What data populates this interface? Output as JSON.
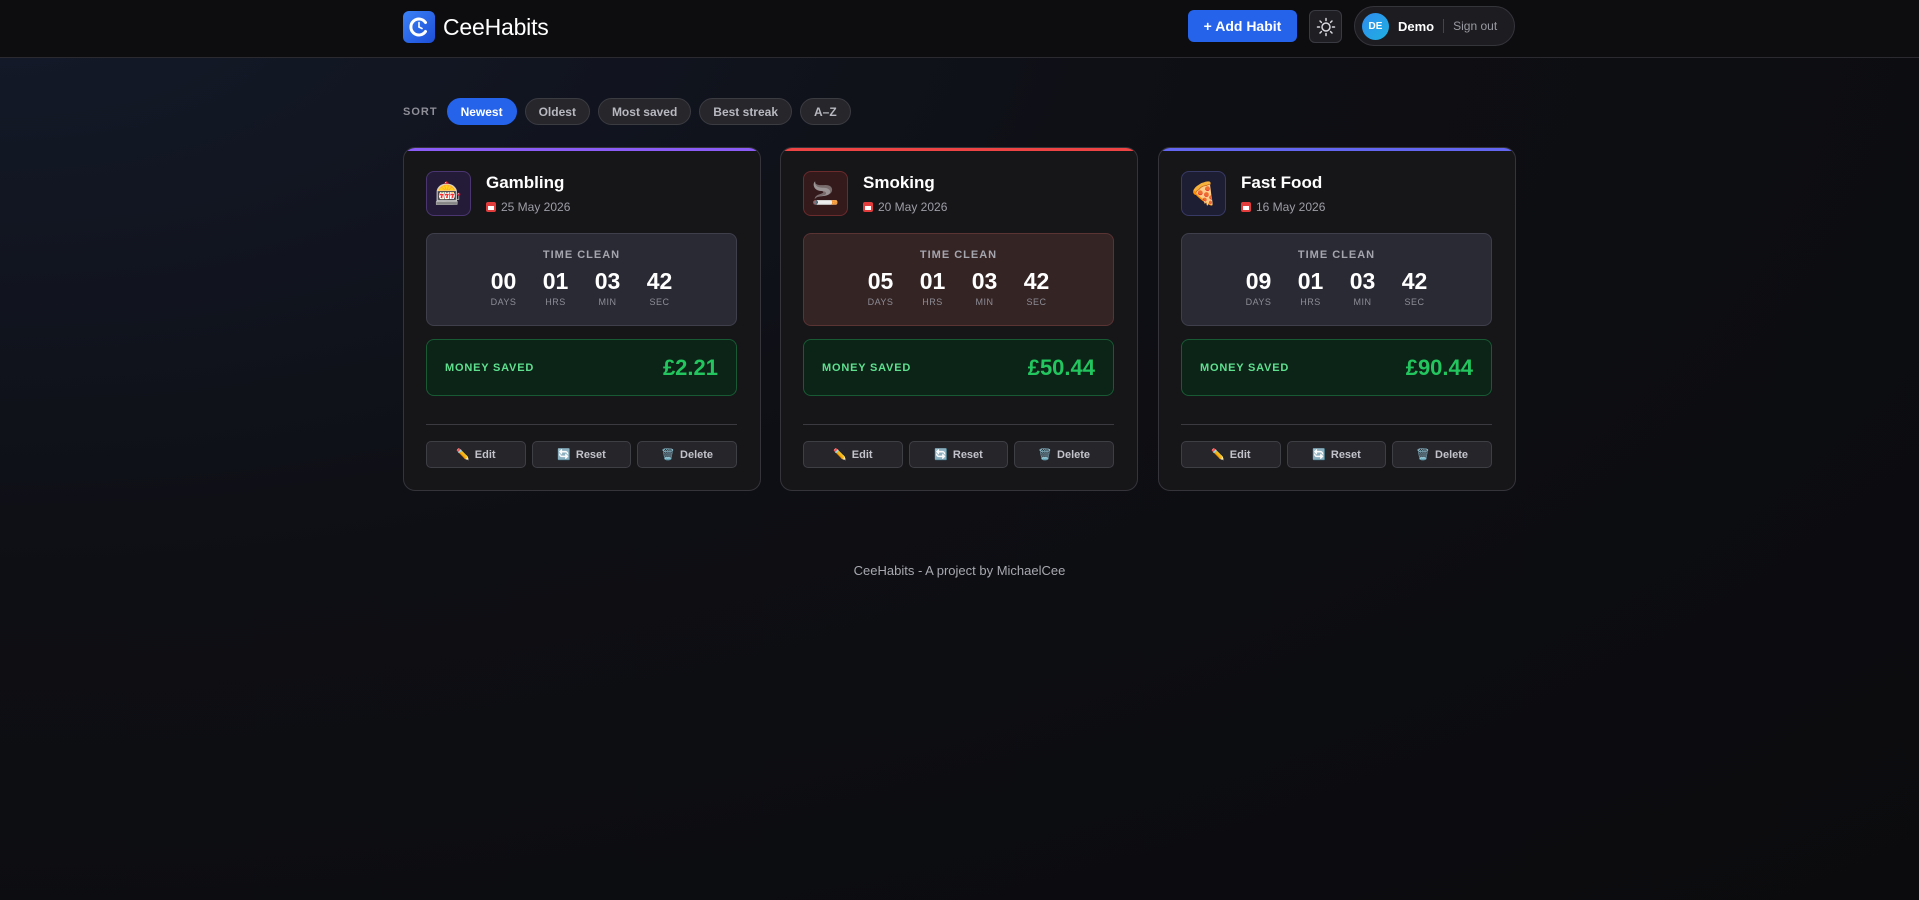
{
  "header": {
    "brand": "CeeHabits",
    "add_habit_label": "+ Add Habit",
    "user_initials": "DE",
    "user_name": "Demo",
    "signout_label": "Sign out"
  },
  "sort": {
    "label": "SORT",
    "options": [
      "Newest",
      "Oldest",
      "Most saved",
      "Best streak",
      "A–Z"
    ],
    "selected": "Newest"
  },
  "cards": [
    {
      "name": "Gambling",
      "icon": "slot-machine-icon",
      "emoji": "🎰",
      "date": "25 May 2026",
      "accent": "#8b5cf6",
      "time_label": "TIME CLEAN",
      "time": [
        {
          "value": "00",
          "unit": "DAYS"
        },
        {
          "value": "01",
          "unit": "HRS"
        },
        {
          "value": "03",
          "unit": "MIN"
        },
        {
          "value": "42",
          "unit": "SEC"
        }
      ],
      "money_label": "MONEY SAVED",
      "money_value": "£2.21",
      "actions": {
        "edit": "Edit",
        "reset": "Reset",
        "delete": "Delete"
      }
    },
    {
      "name": "Smoking",
      "icon": "cigarette-icon",
      "emoji": "🚬",
      "date": "20 May 2026",
      "accent": "#ef4444",
      "time_label": "TIME CLEAN",
      "time": [
        {
          "value": "05",
          "unit": "DAYS"
        },
        {
          "value": "01",
          "unit": "HRS"
        },
        {
          "value": "03",
          "unit": "MIN"
        },
        {
          "value": "42",
          "unit": "SEC"
        }
      ],
      "money_label": "MONEY SAVED",
      "money_value": "£50.44",
      "actions": {
        "edit": "Edit",
        "reset": "Reset",
        "delete": "Delete"
      }
    },
    {
      "name": "Fast Food",
      "icon": "pizza-icon",
      "emoji": "🍕",
      "date": "16 May 2026",
      "accent": "#6366f1",
      "time_label": "TIME CLEAN",
      "time": [
        {
          "value": "09",
          "unit": "DAYS"
        },
        {
          "value": "01",
          "unit": "HRS"
        },
        {
          "value": "03",
          "unit": "MIN"
        },
        {
          "value": "42",
          "unit": "SEC"
        }
      ],
      "money_label": "MONEY SAVED",
      "money_value": "£90.44",
      "actions": {
        "edit": "Edit",
        "reset": "Reset",
        "delete": "Delete"
      }
    }
  ],
  "footer": "CeeHabits - A project by MichaelCee",
  "colors": {
    "primary": "#2563eb",
    "money_green": "#22c55e"
  }
}
